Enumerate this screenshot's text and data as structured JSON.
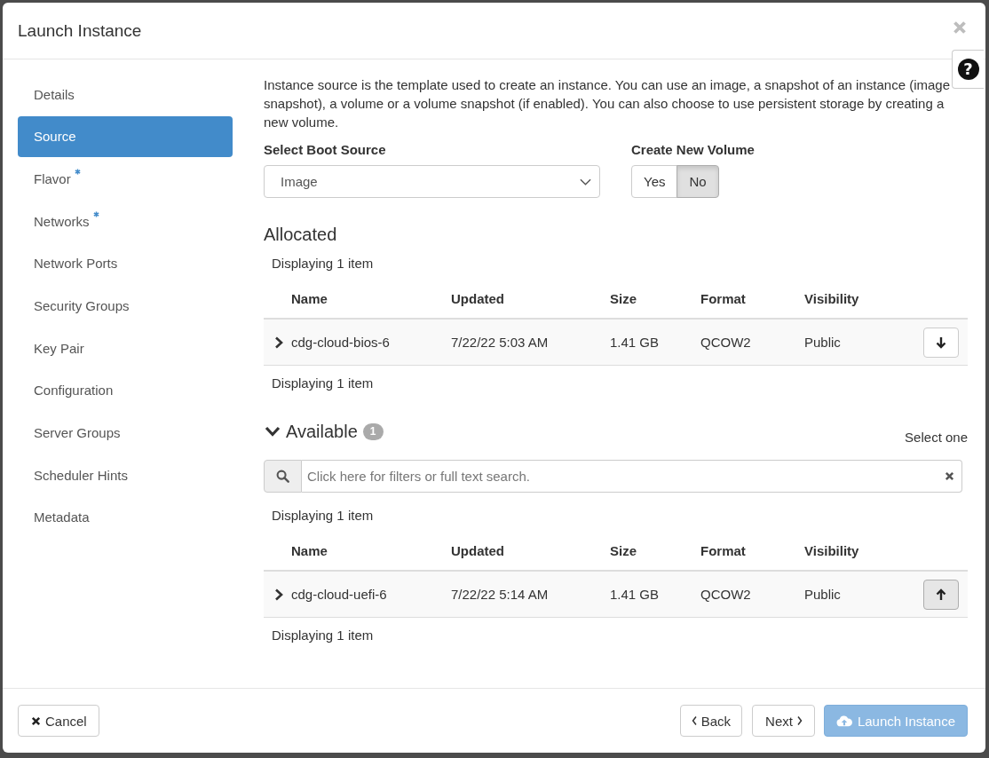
{
  "dialog": {
    "title": "Launch Instance",
    "help_glyph": "?"
  },
  "sidebar": {
    "items": [
      {
        "label": "Details",
        "selected": false,
        "required": false
      },
      {
        "label": "Source",
        "selected": true,
        "required": false
      },
      {
        "label": "Flavor",
        "selected": false,
        "required": true
      },
      {
        "label": "Networks",
        "selected": false,
        "required": true
      },
      {
        "label": "Network Ports",
        "selected": false,
        "required": false
      },
      {
        "label": "Security Groups",
        "selected": false,
        "required": false
      },
      {
        "label": "Key Pair",
        "selected": false,
        "required": false
      },
      {
        "label": "Configuration",
        "selected": false,
        "required": false
      },
      {
        "label": "Server Groups",
        "selected": false,
        "required": false
      },
      {
        "label": "Scheduler Hints",
        "selected": false,
        "required": false
      },
      {
        "label": "Metadata",
        "selected": false,
        "required": false
      }
    ]
  },
  "source": {
    "description": "Instance source is the template used to create an instance. You can use an image, a snapshot of an instance (image snapshot), a volume or a volume snapshot (if enabled). You can also choose to use persistent storage by creating a new volume.",
    "boot_source": {
      "label": "Select Boot Source",
      "value": "Image"
    },
    "create_new_volume": {
      "label": "Create New Volume",
      "options": [
        {
          "label": "Yes",
          "selected": false
        },
        {
          "label": "No",
          "selected": true
        }
      ]
    },
    "allocated": {
      "title": "Allocated",
      "count_top": "Displaying 1 item",
      "columns": [
        "Name",
        "Updated",
        "Size",
        "Format",
        "Visibility"
      ],
      "rows": [
        {
          "expanded": false,
          "cells": [
            "cdg-cloud-bios-6",
            "7/22/22 5:03 AM",
            "1.41 GB",
            "QCOW2",
            "Public"
          ],
          "action": {
            "kind": "down",
            "pressed": false
          }
        }
      ],
      "count_bottom": "Displaying 1 item"
    },
    "available": {
      "title": "Available",
      "expanded": true,
      "badge": "1",
      "hint": "Select one",
      "search": {
        "placeholder": "Click here for filters or full text search."
      },
      "count_top": "Displaying 1 item",
      "columns": [
        "Name",
        "Updated",
        "Size",
        "Format",
        "Visibility"
      ],
      "rows": [
        {
          "expanded": false,
          "cells": [
            "cdg-cloud-uefi-6",
            "7/22/22 5:14 AM",
            "1.41 GB",
            "QCOW2",
            "Public"
          ],
          "action": {
            "kind": "up",
            "pressed": true
          }
        }
      ],
      "count_bottom": "Displaying 1 item"
    }
  },
  "footer": {
    "buttons": [
      {
        "kind": "cancel",
        "label": "Cancel",
        "disabled": false
      },
      {
        "kind": "back",
        "label": "Back",
        "disabled": false
      },
      {
        "kind": "next",
        "label": "Next",
        "disabled": false
      },
      {
        "kind": "launch",
        "label": "Launch Instance",
        "disabled": true
      }
    ]
  }
}
